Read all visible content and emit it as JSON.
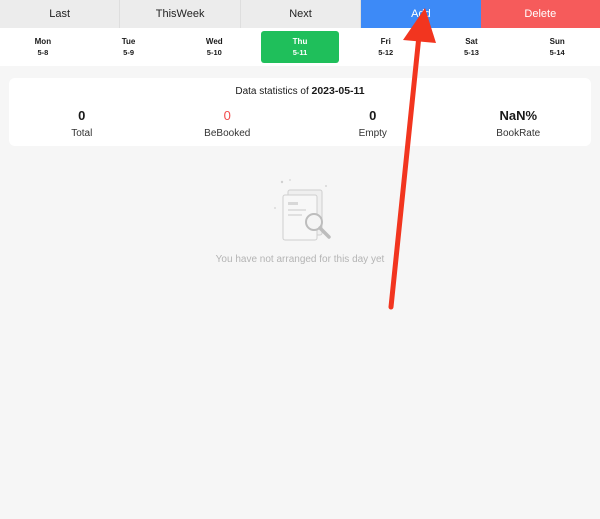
{
  "toolbar": {
    "last_label": "Last",
    "thisweek_label": "ThisWeek",
    "next_label": "Next",
    "add_label": "Add",
    "delete_label": "Delete"
  },
  "week": {
    "days": [
      {
        "name": "Mon",
        "date": "5-8"
      },
      {
        "name": "Tue",
        "date": "5-9"
      },
      {
        "name": "Wed",
        "date": "5-10"
      },
      {
        "name": "Thu",
        "date": "5-11"
      },
      {
        "name": "Fri",
        "date": "5-12"
      },
      {
        "name": "Sat",
        "date": "5-13"
      },
      {
        "name": "Sun",
        "date": "5-14"
      }
    ],
    "selected_day": "Thu"
  },
  "stats": {
    "title_prefix": "Data statistics of",
    "title_date": "2023-05-11",
    "items": [
      {
        "value": "0",
        "label": "Total"
      },
      {
        "value": "0",
        "label": "BeBooked"
      },
      {
        "value": "0",
        "label": "Empty"
      },
      {
        "value": "NaN%",
        "label": "BookRate"
      }
    ]
  },
  "empty_state": {
    "message": "You have not arranged for this day yet",
    "icon": "document-search-icon"
  },
  "colors": {
    "add": "#3d8af7",
    "delete": "#f65b5b",
    "selected_day": "#1fbf5b",
    "booked_value": "#f24b4b",
    "annotation_arrow": "#f2351f"
  }
}
